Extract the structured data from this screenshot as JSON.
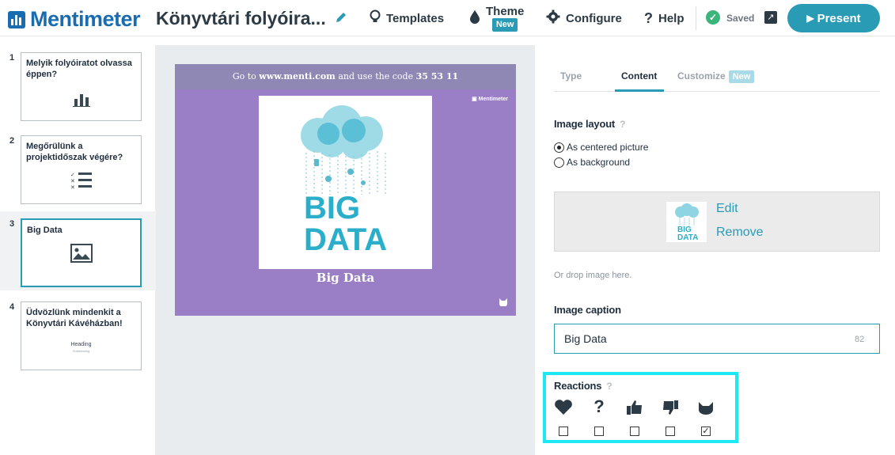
{
  "app": {
    "brand": "Mentimeter",
    "presentation_title": "Könyvtári folyóira..."
  },
  "nav": {
    "templates": "Templates",
    "theme": "Theme",
    "theme_badge": "New",
    "configure": "Configure",
    "help": "Help",
    "saved": "Saved",
    "present": "Present"
  },
  "slides": [
    {
      "num": "1",
      "title": "Melyik folyóiratot olvassa éppen?",
      "icon": "bar-chart-icon"
    },
    {
      "num": "2",
      "title": "Megőrülünk a projektidőszak végére?",
      "icon": "ranking-list-icon"
    },
    {
      "num": "3",
      "title": "Big Data",
      "icon": "image-icon"
    },
    {
      "num": "4",
      "title": "Üdvözlünk mindenkit a Könyvtári Kávéházban!",
      "heading": "Heading",
      "subheading": "Subheading"
    }
  ],
  "preview": {
    "header_prefix": "Go to",
    "header_url": "www.menti.com",
    "header_mid": "and use the code",
    "header_code": "35 53 11",
    "logo_small": "Mentimeter",
    "image_text_1": "BIG",
    "image_text_2": "DATA",
    "caption": "Big Data"
  },
  "panel": {
    "tabs": {
      "type": "Type",
      "content": "Content",
      "customize": "Customize",
      "customize_badge": "New"
    },
    "image_layout_label": "Image layout",
    "help_mark": "?",
    "layout_options": [
      "As centered picture",
      "As background"
    ],
    "edit": "Edit",
    "remove": "Remove",
    "drop_hint": "Or drop image here.",
    "caption_label": "Image caption",
    "caption_value": "Big Data",
    "caption_remaining": "82",
    "reactions_label": "Reactions",
    "reactions": [
      {
        "icon": "heart-icon",
        "checked": false
      },
      {
        "icon": "question-icon",
        "checked": false
      },
      {
        "icon": "thumbs-up-icon",
        "checked": false
      },
      {
        "icon": "thumbs-down-icon",
        "checked": false
      },
      {
        "icon": "cat-icon",
        "checked": true
      }
    ]
  },
  "colors": {
    "accent": "#2a9bb5",
    "brand": "#196cb0",
    "slide_bg": "#9a7fc6",
    "highlight": "#1fe8f5"
  }
}
